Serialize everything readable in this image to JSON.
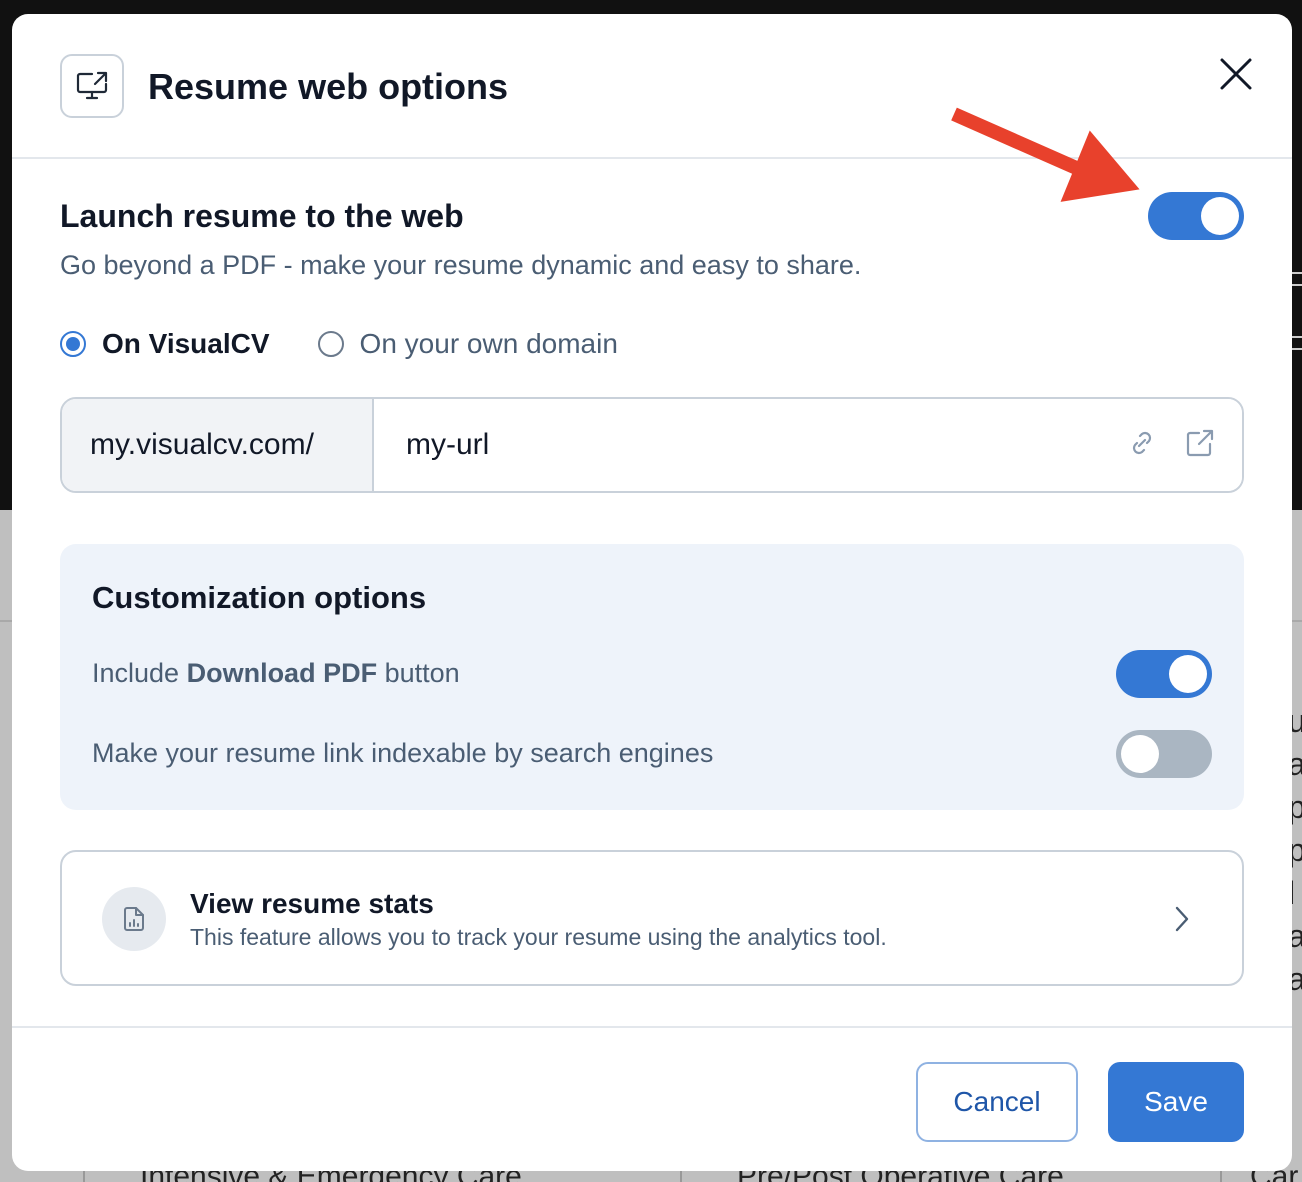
{
  "modal": {
    "title": "Resume web options",
    "header_icon": "monitor-share-icon",
    "close_icon": "close-icon"
  },
  "launch": {
    "title": "Launch resume to the web",
    "subtitle": "Go beyond a PDF - make your resume dynamic and easy to share.",
    "enabled": true
  },
  "hosting": {
    "options": [
      "On VisualCV",
      "On your own domain"
    ],
    "selected": "On VisualCV"
  },
  "url": {
    "prefix": "my.visualcv.com/",
    "value": "my-url",
    "icons": [
      "link-icon",
      "external-link-icon"
    ]
  },
  "customization": {
    "title": "Customization options",
    "options": [
      {
        "prefix": "Include ",
        "bold": "Download PDF",
        "suffix": " button",
        "enabled": true
      },
      {
        "label": "Make your resume link indexable by search engines",
        "enabled": false
      }
    ]
  },
  "stats": {
    "title": "View resume stats",
    "subtitle": "This feature allows you to track your resume using the analytics tool.",
    "icon": "analytics-file-icon"
  },
  "footer": {
    "cancel_label": "Cancel",
    "save_label": "Save"
  },
  "background": {
    "texts": [
      "Intensive & Emergency Care",
      "Pre/Post Operative Care",
      "Car"
    ]
  },
  "colors": {
    "accent": "#3478d4",
    "annotation_arrow": "#e8412c",
    "toggle_off": "#aab6c2"
  }
}
